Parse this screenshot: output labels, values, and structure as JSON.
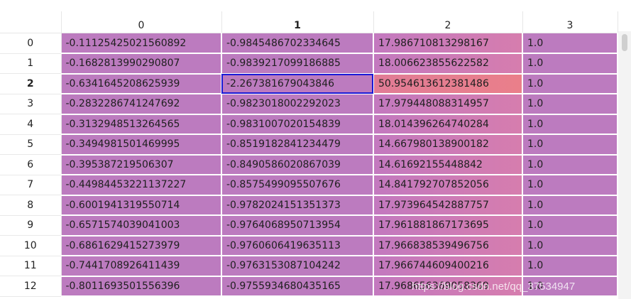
{
  "columns": [
    "0",
    "1",
    "2",
    "3"
  ],
  "bold_column": "1",
  "bold_row": "2",
  "rows": [
    {
      "index": "0",
      "cells": [
        "-0.11125425021560892",
        "-0.9845486702334645",
        "17.986710813298167",
        "1.0"
      ]
    },
    {
      "index": "1",
      "cells": [
        "-0.1682813990290807",
        "-0.9839217099186885",
        "18.006623855622582",
        "1.0"
      ]
    },
    {
      "index": "2",
      "cells": [
        "-0.6341645208625939",
        "-2.267381679043846",
        "50.954613612381486",
        "1.0"
      ]
    },
    {
      "index": "3",
      "cells": [
        "-0.2832286741247692",
        "-0.9823018002292023",
        "17.979448088314957",
        "1.0"
      ]
    },
    {
      "index": "4",
      "cells": [
        "-0.3132948513264565",
        "-0.9831007020154839",
        "18.014396264740284",
        "1.0"
      ]
    },
    {
      "index": "5",
      "cells": [
        "-0.3494981501469995",
        "-0.8519182841234479",
        "14.667980138900182",
        "1.0"
      ]
    },
    {
      "index": "6",
      "cells": [
        "-0.395387219506307",
        "-0.8490586020867039",
        "14.61692155448842",
        "1.0"
      ]
    },
    {
      "index": "7",
      "cells": [
        "-0.44984453221137227",
        "-0.8575499095507676",
        "14.841792707852056",
        "1.0"
      ]
    },
    {
      "index": "8",
      "cells": [
        "-0.6001941319550714",
        "-0.9782024151351373",
        "17.973964542887757",
        "1.0"
      ]
    },
    {
      "index": "9",
      "cells": [
        "-0.6571574039041003",
        "-0.9764068950713954",
        "17.961881867173695",
        "1.0"
      ]
    },
    {
      "index": "10",
      "cells": [
        "-0.6861629415273979",
        "-0.9760606419635113",
        "17.966838539496756",
        "1.0"
      ]
    },
    {
      "index": "11",
      "cells": [
        "-0.7441708926411439",
        "-0.9763153087104242",
        "17.966744609400216",
        "1.0"
      ]
    },
    {
      "index": "12",
      "cells": [
        "-0.8011693501556396",
        "-0.9755934680435165",
        "17.968656369058369",
        "1.0"
      ]
    }
  ],
  "selected_cell": {
    "row": "2",
    "column": "1"
  },
  "colors": {
    "cell_default": "#bc7bbf",
    "col2_gradient_start": "#c379bf",
    "col2_gradient_end": "#d67dae",
    "col2_max_start": "#e17c96",
    "col2_max_end": "#ea7f8a",
    "selection_border": "#1a1ad6"
  },
  "watermark": "https://blog.csdn.net/qq_37534947"
}
